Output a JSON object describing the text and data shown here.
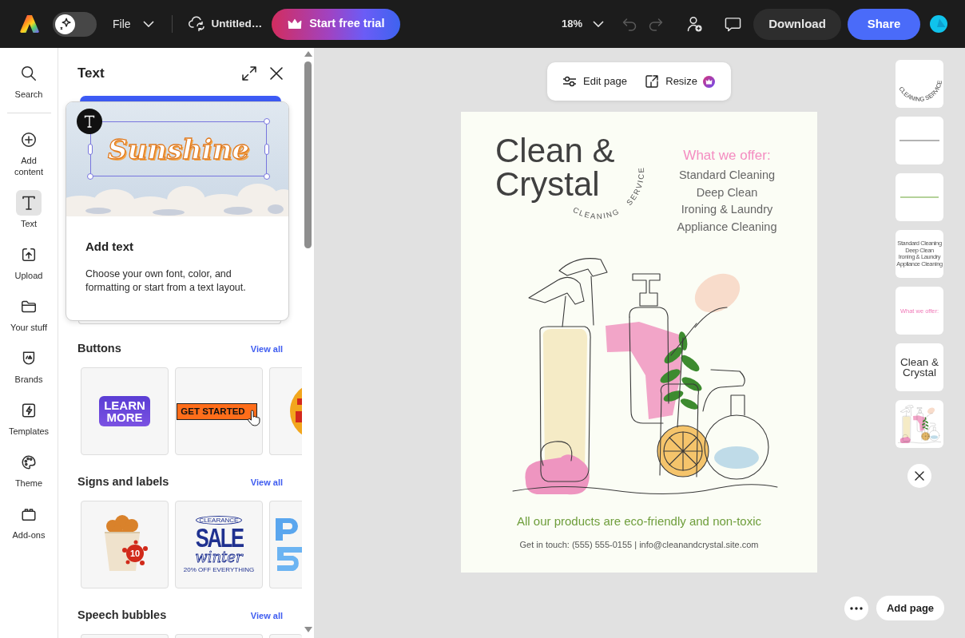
{
  "topbar": {
    "ai_toggle": {
      "on": false
    },
    "file_menu": "File",
    "document_title": "Untitled…",
    "trial_button": "Start free trial",
    "zoom": "18%",
    "undo": {
      "disabled": true
    },
    "redo": {
      "disabled": true
    },
    "download_button": "Download",
    "share_button": "Share"
  },
  "rail": {
    "items": [
      {
        "kind": "search",
        "label": "Search",
        "selected": false
      },
      {
        "kind": "add",
        "label": "Add content",
        "selected": false
      },
      {
        "kind": "text",
        "label": "Text",
        "selected": true
      },
      {
        "kind": "upload",
        "label": "Upload",
        "selected": false
      },
      {
        "kind": "stuff",
        "label": "Your stuff",
        "selected": false
      },
      {
        "kind": "brands",
        "label": "Brands",
        "selected": false
      },
      {
        "kind": "templates",
        "label": "Templates",
        "selected": false
      },
      {
        "kind": "theme",
        "label": "Theme",
        "selected": false
      },
      {
        "kind": "addons",
        "label": "Add-ons",
        "selected": false
      }
    ]
  },
  "panel": {
    "title": "Text",
    "popover": {
      "preview_text": "Sunshine",
      "title": "Add text",
      "description": "Choose your own font, color, and formatting or start from a text layout."
    },
    "sections": [
      {
        "title": "Buttons",
        "link": "View all",
        "tiles": [
          {
            "kind": "learn-more",
            "text": "LEARN MORE"
          },
          {
            "kind": "get-started",
            "text": "GET STARTED"
          },
          {
            "kind": "round-badge"
          }
        ]
      },
      {
        "title": "Signs and labels",
        "link": "View all",
        "tiles": [
          {
            "kind": "bucket",
            "text": "10"
          },
          {
            "kind": "winter-sale",
            "texts": [
              "CLEARANCE",
              "SALE",
              "winter",
              "20% OFF EVERYTHING"
            ]
          },
          {
            "kind": "blue-sign"
          }
        ]
      },
      {
        "title": "Speech bubbles",
        "link": "View all",
        "tiles": [
          {
            "kind": "cut-off"
          },
          {
            "kind": "cut-off"
          },
          {
            "kind": "cut-off"
          }
        ]
      }
    ]
  },
  "canvas": {
    "toolbar": {
      "edit_page": "Edit page",
      "resize": "Resize"
    },
    "page": {
      "title": "Clean & Crystal",
      "tagline_words": [
        "CLEANING",
        "SERVICE"
      ],
      "offer_heading": "What we offer:",
      "services": [
        "Standard Cleaning",
        "Deep Clean",
        "Ironing & Laundry",
        "Appliance Cleaning"
      ],
      "eco_note": "All our products are eco-friendly and non-toxic",
      "contact": "Get in touch: (555) 555-0155 | info@cleanandcrystal.site.com"
    }
  },
  "layers": [
    {
      "kind": "curved-text",
      "text": "CLEANING SERVICE"
    },
    {
      "kind": "contact-line"
    },
    {
      "kind": "eco-line"
    },
    {
      "kind": "list",
      "lines": [
        "Standard Cleaning",
        "Deep Clean",
        "Ironing & Laundry",
        "Appliance Cleaning"
      ]
    },
    {
      "kind": "heading",
      "text": "What we offer:"
    },
    {
      "kind": "title",
      "text": "Clean & Crystal"
    },
    {
      "kind": "illustration"
    }
  ],
  "add_page_button": "Add page"
}
